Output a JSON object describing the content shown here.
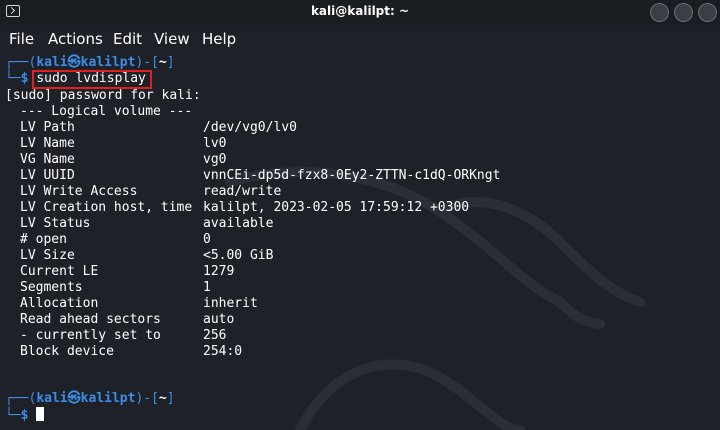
{
  "window": {
    "title": "kali@kalilpt: ~"
  },
  "menu": [
    "File",
    "Actions",
    "Edit",
    "View",
    "Help"
  ],
  "prompt": {
    "user": "kali",
    "host": "kalilpt",
    "dir": "~",
    "symbol": "$"
  },
  "command": "sudo lvdisplay",
  "sudo_prompt": "[sudo] password for kali:",
  "section_header": "--- Logical volume ---",
  "fields": [
    {
      "label": "LV Path",
      "value": "/dev/vg0/lv0"
    },
    {
      "label": "LV Name",
      "value": "lv0"
    },
    {
      "label": "VG Name",
      "value": "vg0"
    },
    {
      "label": "LV UUID",
      "value": "vnnCEi-dp5d-fzx8-0Ey2-ZTTN-c1dQ-ORKngt"
    },
    {
      "label": "LV Write Access",
      "value": "read/write"
    },
    {
      "label": "LV Creation host, time",
      "value": "kalilpt, 2023-02-05 17:59:12 +0300"
    },
    {
      "label": "LV Status",
      "value": "available"
    },
    {
      "label": "# open",
      "value": "0"
    },
    {
      "label": "LV Size",
      "value": "<5.00 GiB"
    },
    {
      "label": "Current LE",
      "value": "1279"
    },
    {
      "label": "Segments",
      "value": "1"
    },
    {
      "label": "Allocation",
      "value": "inherit"
    },
    {
      "label": "Read ahead sectors",
      "value": "auto"
    },
    {
      "label": "- currently set to",
      "value": "256"
    },
    {
      "label": "Block device",
      "value": "254:0"
    }
  ],
  "colors": {
    "prompt_blue": "#3b8eea",
    "highlight_red": "#e02020",
    "background": "#1e2128"
  }
}
